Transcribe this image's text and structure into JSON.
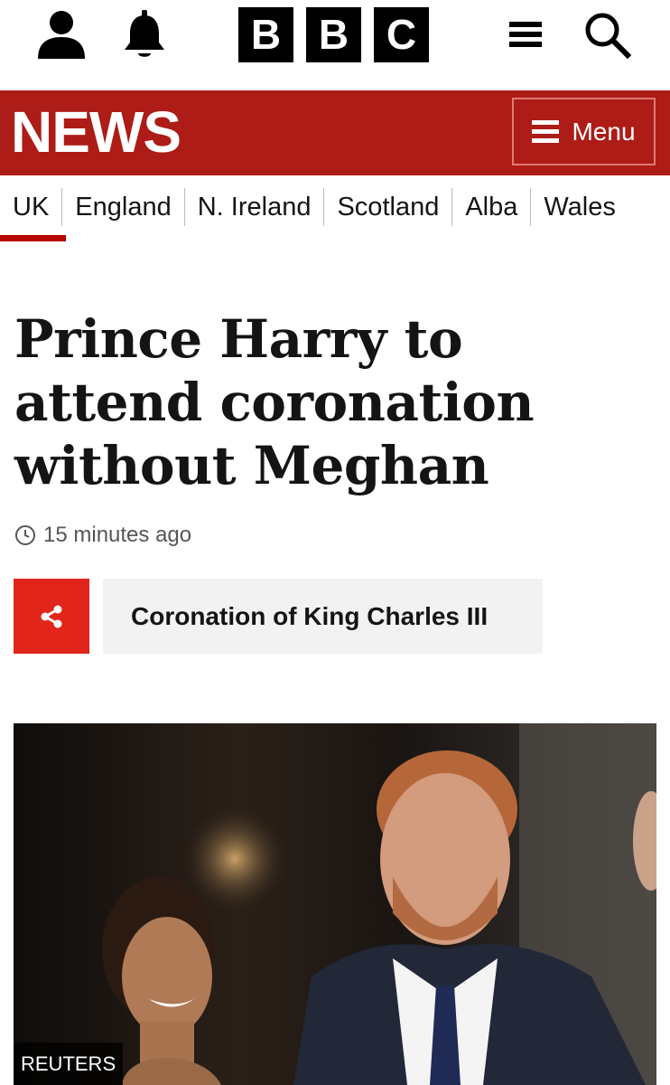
{
  "header": {
    "logo_letters": [
      "B",
      "B",
      "C"
    ],
    "account_icon": "person-icon",
    "notifications_icon": "bell-icon",
    "menu_icon": "hamburger-icon",
    "search_icon": "search-icon"
  },
  "news_bar": {
    "title": "NEWS",
    "menu_label": "Menu",
    "color": "#ad1c17"
  },
  "nav": {
    "items": [
      "UK",
      "England",
      "N. Ireland",
      "Scotland",
      "Alba",
      "Wales"
    ],
    "active_index": 0
  },
  "article": {
    "headline": "Prince Harry to attend coronation without Meghan",
    "timestamp": "15 minutes ago",
    "share_icon": "share-icon",
    "topic": "Coronation of King Charles III",
    "image_credit": "REUTERS"
  },
  "colors": {
    "accent_red": "#b80000",
    "share_red": "#e1251b",
    "tag_bg": "#f2f2f2"
  }
}
